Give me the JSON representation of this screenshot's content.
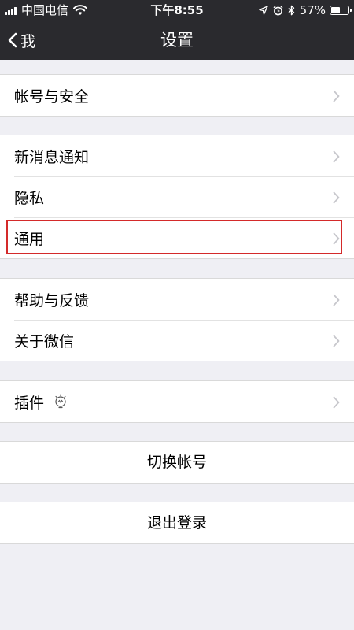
{
  "status_bar": {
    "carrier": "中国电信",
    "time": "下午8:55",
    "battery_percent": "57%",
    "battery_level": 0.57,
    "icons": [
      "signal-icon",
      "wifi-icon",
      "location-arrow-icon",
      "alarm-icon",
      "bluetooth-icon",
      "battery-icon"
    ]
  },
  "nav": {
    "back_label": "我",
    "title": "设置"
  },
  "groups": {
    "account": {
      "label": "帐号与安全"
    },
    "notifications": {
      "label": "新消息通知"
    },
    "privacy": {
      "label": "隐私"
    },
    "general": {
      "label": "通用",
      "highlighted": true,
      "highlight_color": "#d42a2a"
    },
    "help": {
      "label": "帮助与反馈"
    },
    "about": {
      "label": "关于微信"
    },
    "plugins": {
      "label": "插件",
      "icon": "lightbulb-icon"
    }
  },
  "actions": {
    "switch_account": "切换帐号",
    "logout": "退出登录"
  },
  "colors": {
    "header_bg": "#2a2a2e",
    "page_bg": "#efeff4",
    "chevron": "#c7c7cc"
  }
}
